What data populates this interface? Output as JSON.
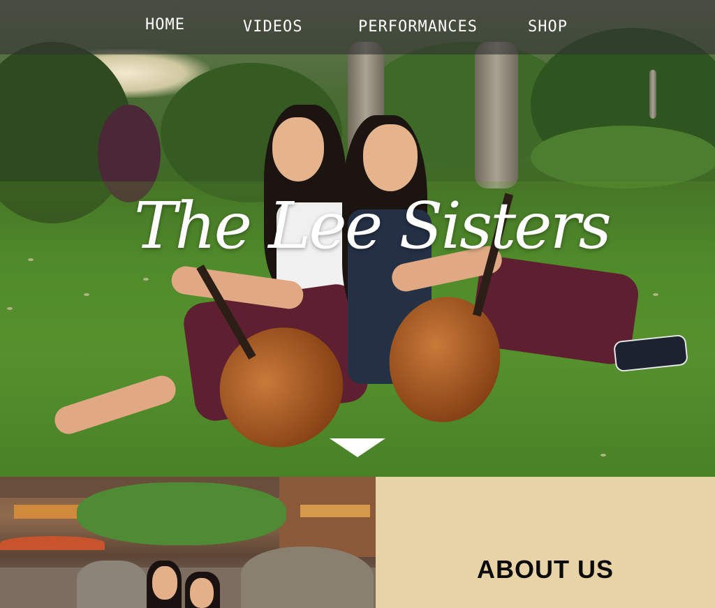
{
  "nav": {
    "items": [
      {
        "label": "HOME"
      },
      {
        "label": "VIDEOS"
      },
      {
        "label": "PERFORMANCES"
      },
      {
        "label": "SHOP"
      }
    ]
  },
  "hero": {
    "title": "The Lee Sisters"
  },
  "about": {
    "title": "ABOUT US"
  },
  "colors": {
    "nav_bar": "#323232",
    "about_panel": "#e8d3a6",
    "text_light": "#ffffff",
    "text_dark": "#0a0a0a"
  },
  "icons": {
    "scroll_indicator": "triangle-down-icon"
  }
}
